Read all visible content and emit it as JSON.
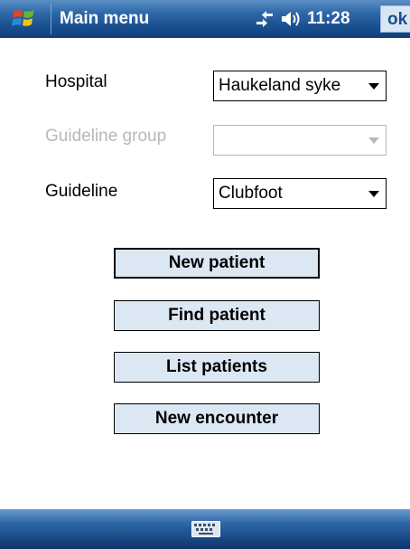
{
  "title_bar": {
    "title": "Main menu",
    "time": "11:28",
    "ok_label": "ok",
    "icons": [
      "windows-start-icon",
      "connectivity-icon",
      "volume-icon"
    ]
  },
  "form": {
    "hospital": {
      "label": "Hospital",
      "value": "Haukeland syke",
      "enabled": true
    },
    "guideline_group": {
      "label": "Guideline group",
      "value": "",
      "enabled": false
    },
    "guideline": {
      "label": "Guideline",
      "value": "Clubfoot",
      "enabled": true
    }
  },
  "buttons": [
    {
      "label": "New patient",
      "focused": true
    },
    {
      "label": "Find patient",
      "focused": false
    },
    {
      "label": "List patients",
      "focused": false
    },
    {
      "label": "New encounter",
      "focused": false
    }
  ],
  "menu_bar": {
    "icon": "keyboard-icon"
  },
  "colors": {
    "title_bar": "#2d67a8",
    "button_fill": "#dbe7f3",
    "disabled_text": "#b8b8b8"
  }
}
